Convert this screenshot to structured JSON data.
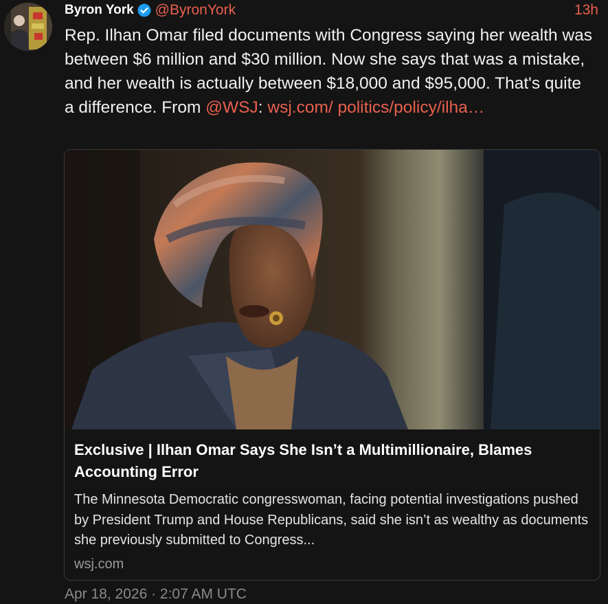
{
  "tweet": {
    "author": {
      "display_name": "Byron York",
      "handle": "@ByronYork",
      "verified": true,
      "avatar_icon": "avatar-photo"
    },
    "relative_time": "13h",
    "text_before_mention": "Rep. Ilhan Omar filed documents with Congress saying her wealth was between $6 million and $30 million. Now she says that was a mistake, and her wealth is actually between $18,000 and $95,000. That's quite a difference. From ",
    "mention": "@WSJ",
    "text_after_mention": ": ",
    "link_text": "wsj.com/ politics/policy/ilha…",
    "full_timestamp": "Apr 18, 2026 · 2:07 AM UTC"
  },
  "card": {
    "title": "Exclusive | Ilhan Omar Says She Isn’t a Multimillionaire, Blames Accounting Error",
    "description": "The Minnesota Democratic congresswoman, facing potential investigations pushed by President Trump and House Republicans, said she isn’t as wealthy as documents she previously submitted to Congress...",
    "domain": "wsj.com"
  },
  "colors": {
    "background": "#141414",
    "accent_link": "#e8604e",
    "verified_blue": "#1d9bf0",
    "muted": "#8a8a8a"
  }
}
